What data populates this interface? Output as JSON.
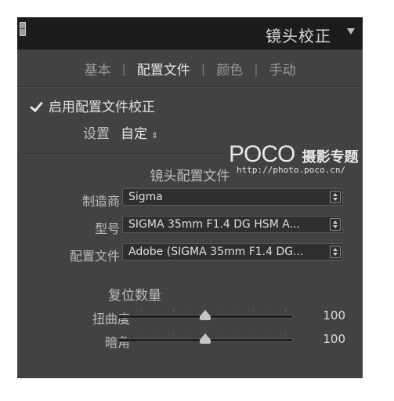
{
  "header": {
    "title": "镜头校正"
  },
  "tabs": [
    {
      "label": "基本",
      "active": false
    },
    {
      "label": "配置文件",
      "active": true
    },
    {
      "label": "颜色",
      "active": false
    },
    {
      "label": "手动",
      "active": false
    }
  ],
  "tab_separator": "|",
  "enable": {
    "label": "启用配置文件校正",
    "checked": true
  },
  "setup": {
    "label": "设置",
    "value": "自定",
    "stepper": "⇕"
  },
  "watermark": {
    "logo": "POCO",
    "title": "摄影专题",
    "url": "http://photo.poco.cn/"
  },
  "lens_profile": {
    "title": "镜头配置文件",
    "fields": [
      {
        "label": "制造商",
        "value": "Sigma"
      },
      {
        "label": "型号",
        "value": "SIGMA 35mm F1.4 DG HSM A..."
      },
      {
        "label": "配置文件",
        "value": "Adobe (SIGMA 35mm F1.4 DG..."
      }
    ]
  },
  "amount": {
    "title": "复位数量",
    "sliders": [
      {
        "label": "扭曲度",
        "value": "100",
        "fraction": 0.5
      },
      {
        "label": "暗角",
        "value": "100",
        "fraction": 0.5
      }
    ]
  }
}
